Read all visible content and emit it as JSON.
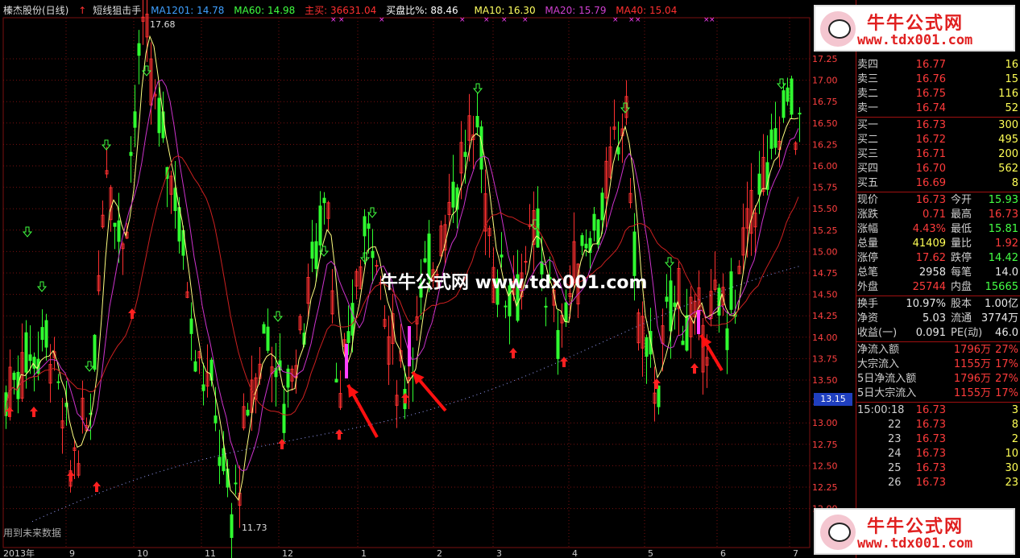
{
  "header": {
    "stock": "榛杰股份(日线)",
    "indicator": "短线狙击手",
    "ma1201": "MA1201: 14.78",
    "ma60": "MA60: 14.98",
    "zhumai": "主买: 36631.04",
    "ratio": "买盘比%: 88.46",
    "ma10": "MA10: 16.30",
    "ma20": "MA20: 15.79",
    "ma40": "MA40: 15.04",
    "high_label": "17.68",
    "low_label": "11.73",
    "future_note": "用到未来数据",
    "center_watermark": "牛牛公式网  www.tdx001.com",
    "current_price_tag": "13.15"
  },
  "y_axis": [
    "17.25",
    "17.00",
    "16.75",
    "16.50",
    "16.25",
    "16.00",
    "15.75",
    "15.50",
    "15.25",
    "15.00",
    "14.75",
    "14.50",
    "14.25",
    "14.00",
    "13.75",
    "13.50",
    "13.25",
    "13.00",
    "12.75",
    "12.50",
    "12.25",
    "12.00"
  ],
  "x_axis": [
    "2013年",
    "9",
    "10",
    "11",
    "12",
    "1",
    "2",
    "3",
    "4",
    "5",
    "6",
    "7"
  ],
  "quote": {
    "sell": [
      {
        "label": "卖四",
        "price": "16.77",
        "vol": "16"
      },
      {
        "label": "卖三",
        "price": "16.76",
        "vol": "15"
      },
      {
        "label": "卖二",
        "price": "16.75",
        "vol": "116"
      },
      {
        "label": "卖一",
        "price": "16.74",
        "vol": "52"
      }
    ],
    "buy": [
      {
        "label": "买一",
        "price": "16.73",
        "vol": "300"
      },
      {
        "label": "买二",
        "price": "16.72",
        "vol": "495"
      },
      {
        "label": "买三",
        "price": "16.71",
        "vol": "200"
      },
      {
        "label": "买四",
        "price": "16.70",
        "vol": "562"
      },
      {
        "label": "买五",
        "price": "16.69",
        "vol": "8"
      }
    ],
    "stats": [
      {
        "l1": "现价",
        "v1": "16.73",
        "l2": "今开",
        "v2": "15.93",
        "c1": "red",
        "c2": "grn"
      },
      {
        "l1": "涨跌",
        "v1": "0.71",
        "l2": "最高",
        "v2": "16.73",
        "c1": "red",
        "c2": "red"
      },
      {
        "l1": "涨幅",
        "v1": "4.43%",
        "l2": "最低",
        "v2": "15.81",
        "c1": "red",
        "c2": "grn"
      },
      {
        "l1": "总量",
        "v1": "41409",
        "l2": "量比",
        "v2": "1.92",
        "c1": "yel",
        "c2": "red"
      },
      {
        "l1": "涨停",
        "v1": "17.62",
        "l2": "跌停",
        "v2": "14.42",
        "c1": "red",
        "c2": "grn"
      },
      {
        "l1": "总笔",
        "v1": "2958",
        "l2": "每笔",
        "v2": "14.0",
        "c1": "wht",
        "c2": "wht"
      },
      {
        "l1": "外盘",
        "v1": "25744",
        "l2": "内盘",
        "v2": "15665",
        "c1": "red",
        "c2": "grn"
      }
    ],
    "stats2": [
      {
        "l1": "换手",
        "v1": "10.97%",
        "l2": "股本",
        "v2": "1.00亿",
        "c1": "wht",
        "c2": "wht"
      },
      {
        "l1": "净资",
        "v1": "5.03",
        "l2": "流通",
        "v2": "3774万",
        "c1": "wht",
        "c2": "wht"
      },
      {
        "l1": "收益(一)",
        "v1": "0.091",
        "l2": "PE(动)",
        "v2": "46.0",
        "c1": "wht",
        "c2": "wht"
      }
    ],
    "flows": [
      {
        "label": "净流入额",
        "val": "1796万",
        "pct": "27%"
      },
      {
        "label": "大宗流入",
        "val": "1155万",
        "pct": "17%"
      },
      {
        "label": "5日净流入额",
        "val": "1796万",
        "pct": "27%"
      },
      {
        "label": "5日大宗流入",
        "val": "1155万",
        "pct": "17%"
      }
    ],
    "ticks": [
      {
        "time": "15:00:18",
        "price": "16.73",
        "vol": "3"
      },
      {
        "time": "22",
        "price": "16.73",
        "vol": "8"
      },
      {
        "time": "23",
        "price": "16.73",
        "vol": "2"
      },
      {
        "time": "24",
        "price": "16.73",
        "vol": "10"
      },
      {
        "time": "25",
        "price": "16.73",
        "vol": "30"
      },
      {
        "time": "26",
        "price": "16.73",
        "vol": "23"
      }
    ]
  },
  "watermark": {
    "title": "牛牛公式网",
    "url": "www.tdx001.com"
  },
  "colors": {
    "up": "#ff3030",
    "down": "#30ff30",
    "ma10": "#ffff80",
    "ma20": "#cc33cc",
    "ma40": "#cc2020",
    "grid": "#7a1010"
  }
}
